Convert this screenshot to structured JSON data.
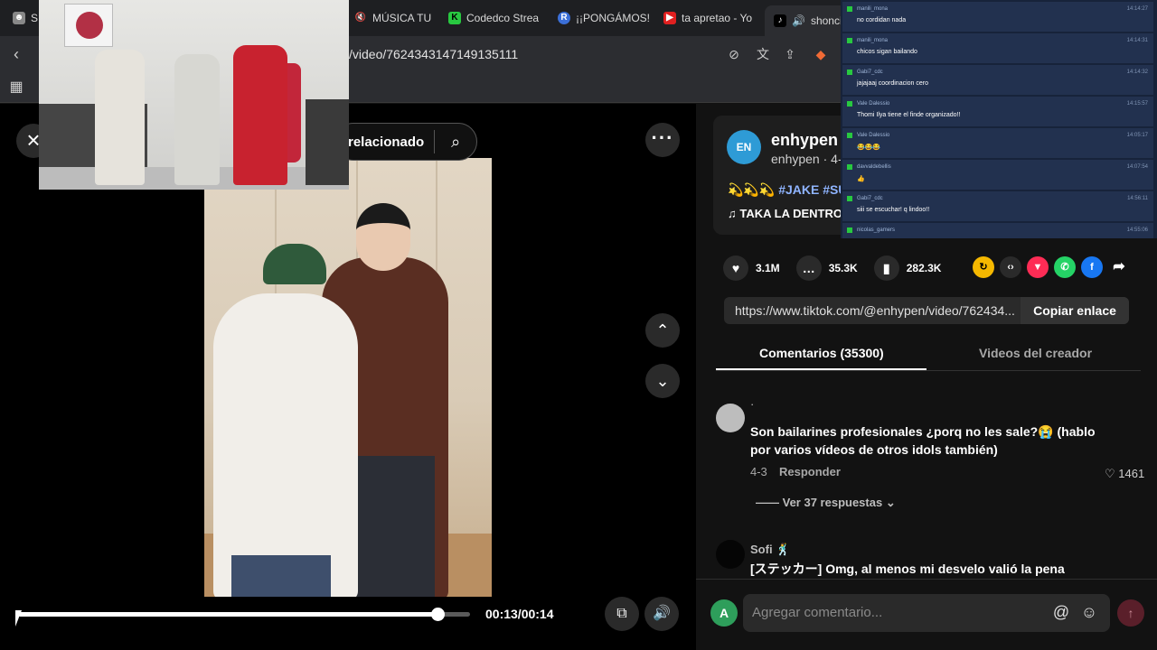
{
  "browser": {
    "tabs": [
      {
        "label": "S",
        "color": "#888888"
      },
      {
        "label": "MÚSICA TU",
        "color": "#d81f26"
      },
      {
        "label": "Codedco Strea",
        "color": "#28c840"
      },
      {
        "label": "¡¡PONGÁMOS!",
        "color": "#3b6fd8"
      },
      {
        "label": "ta apretao - Yo",
        "color": "#e02020"
      },
      {
        "label": "shonci",
        "color": "#000000"
      }
    ],
    "url": "/video/7624343147149135111"
  },
  "player": {
    "search_label": "relacionado",
    "time": "00:13/00:14",
    "progress_fraction": 0.9286
  },
  "post": {
    "avatar_text": "EN",
    "author": "enhypen",
    "author_sub": "enhypen · 4-",
    "caption_emoji": "💫💫💫",
    "caption_tags": "#JAKE #SU",
    "music": "TAKA LA DENTRO",
    "likes": "3.1M",
    "comments": "35.3K",
    "saves": "282.3K",
    "link": "https://www.tiktok.com/@enhypen/video/762434...",
    "copy_label": "Copiar enlace"
  },
  "tabs": {
    "comments": "Comentarios (35300)",
    "creator": "Videos del creador"
  },
  "comments": [
    {
      "user": "·",
      "text_line1": "Son bailarines profesionales ¿porq no les sale?😭 (hablo",
      "text_line2": "por varios vídeos de otros idols también)",
      "date": "4-3",
      "reply": "Responder",
      "likes": "1461",
      "replies": "Ver 37 respuestas"
    },
    {
      "user": "Sofi 🕺",
      "text_line1": "[ステッカー] Omg, al menos mi desvelo valió la pena"
    }
  ],
  "composer": {
    "avatar": "A",
    "placeholder": "Agregar comentario..."
  },
  "chat": [
    {
      "user": "manili_mona",
      "text": "no cordidan nada",
      "time": "14:14:27"
    },
    {
      "user": "manili_mona",
      "text": "chicos sigan bailando",
      "time": "14:14:31"
    },
    {
      "user": "Gabi7_cdc",
      "text": "jajajaaj coordinacion cero",
      "time": "14:14:32"
    },
    {
      "user": "Vale Dalessio",
      "text": "Thomi Ilya tiene el finde organizado!!",
      "time": "14:15:57"
    },
    {
      "user": "Vale Dalessio",
      "text": "😂😂😂",
      "time": "14:05:17"
    },
    {
      "user": "davvaldebellis",
      "text": "👍",
      "time": "14:07:54"
    },
    {
      "user": "Gabi7_cdc",
      "text": "siii se escuchar! q lindoo!!",
      "time": "14:56:11"
    },
    {
      "user": "nicolas_gamers",
      "text": "",
      "time": "14:55:06"
    }
  ]
}
